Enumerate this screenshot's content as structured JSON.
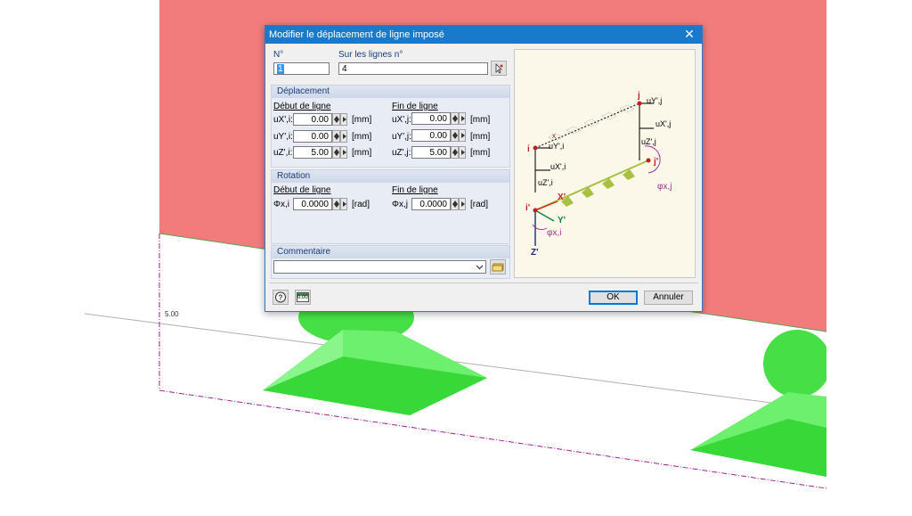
{
  "dialog": {
    "title": "Modifier le déplacement de ligne imposé",
    "close_glyph": "✕"
  },
  "header": {
    "no_label": "N°",
    "no_value": "1",
    "lines_label": "Sur les lignes n°",
    "lines_value": "4"
  },
  "displacement": {
    "title": "Déplacement",
    "start_label": "Début de ligne",
    "end_label": "Fin de ligne",
    "start": [
      {
        "label": "uX',i:",
        "value": "0.00",
        "unit": "[mm]"
      },
      {
        "label": "uY',i:",
        "value": "0.00",
        "unit": "[mm]"
      },
      {
        "label": "uZ',i:",
        "value": "5.00",
        "unit": "[mm]"
      }
    ],
    "end": [
      {
        "label": "uX',j:",
        "value": "0.00",
        "unit": "[mm]"
      },
      {
        "label": "uY',j:",
        "value": "0.00",
        "unit": "[mm]"
      },
      {
        "label": "uZ',j:",
        "value": "5.00",
        "unit": "[mm]"
      }
    ]
  },
  "rotation": {
    "title": "Rotation",
    "start_label": "Début de ligne",
    "end_label": "Fin de ligne",
    "start": {
      "label": "Φx,i",
      "value": "0.0000",
      "unit": "[rad]"
    },
    "end": {
      "label": "Φx,j",
      "value": "0.0000",
      "unit": "[rad]"
    }
  },
  "comment": {
    "label": "Commentaire",
    "value": ""
  },
  "buttons": {
    "ok": "OK",
    "cancel": "Annuler",
    "units_icon_text": "0.00"
  },
  "preview": {
    "labels": {
      "j": "j",
      "i": "i",
      "uyj": "uY',j",
      "uxj": "uX',j",
      "uzj": "uZ',j",
      "jp": "j'",
      "phixj": "φx,j",
      "uyi": "uY',i",
      "uxi": "uX',i",
      "uzi": "uZ',i",
      "xp": "X'",
      "yp": "Y'",
      "zp": "Z'",
      "ip": "i'",
      "phixi": "φx,i",
      "xsmall": "x"
    }
  },
  "viewport": {
    "dim_label": "5.00"
  },
  "colors": {
    "wall": "#f08080",
    "support": "#55e855",
    "dim_line": "#a0209a",
    "titlebar": "#1979ca"
  }
}
